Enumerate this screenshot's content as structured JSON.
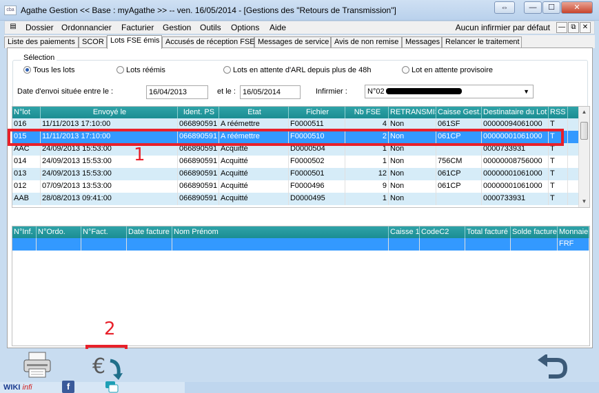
{
  "window": {
    "app_icon_text": "cba",
    "title": "Agathe Gestion << Base : myAgathe >>   --   ven. 16/05/2014  -  [Gestions des \"Retours de Transmission\"]",
    "btn_swap": "⇔",
    "btn_min": "—",
    "btn_max": "☐",
    "btn_close": "✕"
  },
  "menu": {
    "items": [
      "Dossier",
      "Ordonnancier",
      "Facturier",
      "Gestion",
      "Outils",
      "Options",
      "Aide"
    ],
    "right_text": "Aucun infirmier par défaut",
    "mdi_min": "—",
    "mdi_restore": "⧉",
    "mdi_close": "✕"
  },
  "tabs": [
    "Liste des paiements",
    "SCOR",
    "Lots FSE émis",
    "Accusés de réception FSE",
    "Messages de service",
    "Avis de non remise",
    "Messages",
    "Relancer le traitement"
  ],
  "active_tab": 2,
  "selection": {
    "legend": "Sélection",
    "radios": [
      {
        "label": "Tous les lots",
        "checked": true
      },
      {
        "label": "Lots réémis",
        "checked": false
      },
      {
        "label": "Lots en attente d'ARL depuis plus de 48h",
        "checked": false
      },
      {
        "label": "Lot en attente provisoire",
        "checked": false
      }
    ],
    "date_label": "Date d'envoi située entre le :",
    "date_from": "16/04/2013",
    "and_label": "et le :",
    "date_to": "16/05/2014",
    "nurse_label": "Infirmier :",
    "nurse_value_prefix": "N°02"
  },
  "lots_table": {
    "columns": [
      "N°lot",
      "Envoyé le",
      "Ident. PS",
      "Etat",
      "Fichier",
      "Nb FSE",
      "RETRANSMIS",
      "Caisse Gest.",
      "Destinataire du Lot",
      "RSS"
    ],
    "rows": [
      [
        "016",
        "11/11/2013 17:10:00",
        "066890591",
        "A réémettre",
        "F0000511",
        "4",
        "Non",
        "061SF",
        "00000094061000",
        "T"
      ],
      [
        "015",
        "11/11/2013 17:10:00",
        "066890591",
        "A réémettre",
        "F0000510",
        "2",
        "Non",
        "061CP",
        "00000001061000",
        "T"
      ],
      [
        "AAC",
        "24/09/2013 15:53:00",
        "066890591",
        "Acquitté",
        "D0000504",
        "1",
        "Non",
        "",
        "0000733931",
        "T"
      ],
      [
        "014",
        "24/09/2013 15:53:00",
        "066890591",
        "Acquitté",
        "F0000502",
        "1",
        "Non",
        "756CM",
        "00000008756000",
        "T"
      ],
      [
        "013",
        "24/09/2013 15:53:00",
        "066890591",
        "Acquitté",
        "F0000501",
        "12",
        "Non",
        "061CP",
        "00000001061000",
        "T"
      ],
      [
        "012",
        "07/09/2013 13:53:00",
        "066890591",
        "Acquitté",
        "F0000496",
        "9",
        "Non",
        "061CP",
        "00000001061000",
        "T"
      ],
      [
        "AAB",
        "28/08/2013 09:41:00",
        "066890591",
        "Acquitté",
        "D0000495",
        "1",
        "Non",
        "",
        "0000733931",
        "T"
      ]
    ],
    "selected_row": 1
  },
  "detail_table": {
    "columns": [
      "N°Inf.",
      "N°Ordo.",
      "N°Fact.",
      "Date facture",
      "Nom Prénom",
      "Caisse 1",
      "CodeC2",
      "Total facturé",
      "Solde facture",
      "Monnaie"
    ],
    "rows": [
      [
        "",
        "",
        "",
        "",
        "",
        "",
        "",
        "",
        "",
        "FRF"
      ]
    ]
  },
  "annotations": {
    "one": "1",
    "two": "2"
  },
  "footer": {
    "wiki_w": "WIKI",
    "wiki_i": "infi",
    "fb": "f"
  },
  "colors": {
    "grid_header": "#1b8d92",
    "row_alt": "#d6ecf8",
    "row_selected": "#3399ff",
    "annotation": "#e8202a"
  }
}
